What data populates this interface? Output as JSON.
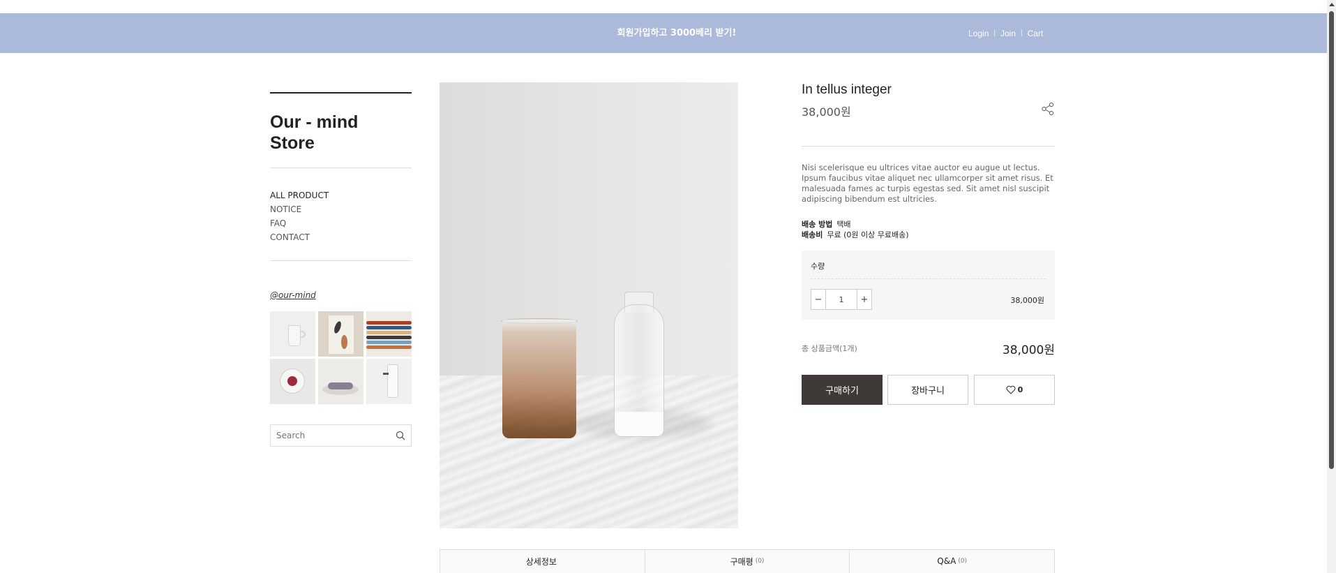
{
  "banner": {
    "promo_text": "회원가입하고 3000베리 받기!",
    "links": [
      "Login",
      "Join",
      "Cart"
    ],
    "background": "#abb9da"
  },
  "sidebar": {
    "store_title_line1": "Our - mind",
    "store_title_line2": "Store",
    "nav": [
      "ALL PRODUCT",
      "NOTICE",
      "FAQ",
      "CONTACT"
    ],
    "instagram_handle": "@our-mind",
    "search_placeholder": "Search"
  },
  "product": {
    "name": "In tellus integer",
    "price": "38,000원",
    "description": "Nisi scelerisque eu ultrices vitae auctor eu augue ut lectus. Ipsum faucibus vitae aliquet nec ullamcorper sit amet risus. Et malesuada fames ac turpis egestas sed. Sit amet nisl suscipit adipiscing bibendum est ultricies.",
    "shipping_method_label": "배송 방법",
    "shipping_method_value": "택배",
    "shipping_fee_label": "배송비",
    "shipping_fee_value": "무료 (0원 이상 무료배송)",
    "quantity_label": "수량",
    "quantity": "1",
    "line_price": "38,000원",
    "total_label": "총 상품금액(1개)",
    "total_price": "38,000원",
    "buy_label": "구매하기",
    "cart_label": "장바구니",
    "wish_count": "0",
    "buy_button_color": "#3f3a38"
  },
  "tabs": [
    {
      "label": "상세정보",
      "count": ""
    },
    {
      "label": "구매평",
      "count": "(0)"
    },
    {
      "label": "Q&A",
      "count": "(0)"
    }
  ],
  "icons": {
    "share": "share-icon",
    "search": "search-icon",
    "wish": "heart-icon",
    "minus": "minus-icon",
    "plus": "plus-icon"
  }
}
